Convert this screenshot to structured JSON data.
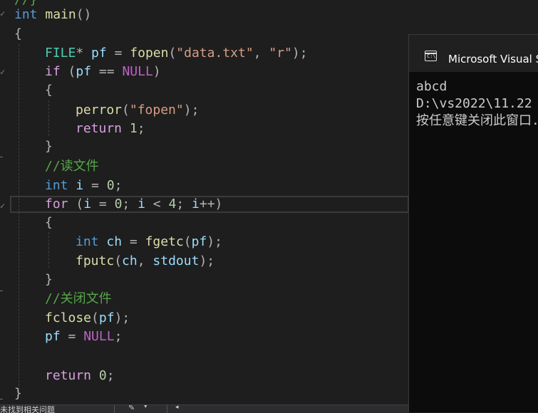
{
  "editor": {
    "lines": [
      {
        "t": "//}"
      },
      {
        "t": "int main()"
      },
      {
        "t": "{"
      },
      {
        "t": "FILE* pf = fopen(\"data.txt\", \"r\");"
      },
      {
        "t": "if (pf == NULL)"
      },
      {
        "t": "{"
      },
      {
        "t": "perror(\"fopen\");"
      },
      {
        "t": "return 1;"
      },
      {
        "t": "}"
      },
      {
        "t": "//读文件"
      },
      {
        "t": "int i = 0;"
      },
      {
        "t": "for (i = 0; i < 4; i++)"
      },
      {
        "t": "{"
      },
      {
        "t": "int ch = fgetc(pf);"
      },
      {
        "t": "fputc(ch, stdout);"
      },
      {
        "t": "}"
      },
      {
        "t": "//关闭文件"
      },
      {
        "t": "fclose(pf);"
      },
      {
        "t": "pf = NULL;"
      },
      {
        "t": ""
      },
      {
        "t": "return 0;"
      },
      {
        "t": "}"
      }
    ],
    "tokens": {
      "l1_int": "int",
      "l1_main": "main",
      "l1_paren": "()",
      "l3_file": "FILE",
      "l3_star": "*",
      "l3_pf": "pf",
      "l3_eq": "=",
      "l3_fopen": "fopen",
      "l3_po": "(",
      "l3_s1": "\"data.txt\"",
      "l3_comma": ",",
      "l3_s2": "\"r\"",
      "l3_pc": ");",
      "l4_if": "if",
      "l4_po": "(",
      "l4_pf": "pf",
      "l4_eq": "==",
      "l4_null": "NULL",
      "l4_pc": ")",
      "l6_perror": "perror",
      "l6_po": "(",
      "l6_s": "\"fopen\"",
      "l6_pc": ");",
      "l7_return": "return",
      "l7_num": "1",
      "l7_semi": ";",
      "l9_cmt": "//读文件",
      "l10_int": "int",
      "l10_i": "i",
      "l10_eq": "=",
      "l10_num": "0",
      "l10_semi": ";",
      "l11_for": "for",
      "l11_po": "(",
      "l11_i1": "i",
      "l11_eq": "=",
      "l11_n0": "0",
      "l11_s1": ";",
      "l11_i2": "i",
      "l11_lt": "<",
      "l11_n4": "4",
      "l11_s2": ";",
      "l11_i3": "i",
      "l11_pp": "++",
      "l11_pc": ")",
      "l13_int": "int",
      "l13_ch": "ch",
      "l13_eq": "=",
      "l13_fgetc": "fgetc",
      "l13_po": "(",
      "l13_pf": "pf",
      "l13_pc": ");",
      "l14_fputc": "fputc",
      "l14_po": "(",
      "l14_ch": "ch",
      "l14_comma": ",",
      "l14_stdout": "stdout",
      "l14_pc": ");",
      "l16_cmt": "//关闭文件",
      "l17_fclose": "fclose",
      "l17_po": "(",
      "l17_pf": "pf",
      "l17_pc": ");",
      "l18_pf": "pf",
      "l18_eq": "=",
      "l18_null": "NULL",
      "l18_semi": ";",
      "l20_return": "return",
      "l20_num": "0",
      "l20_semi": ";"
    }
  },
  "status_bar": {
    "issues_text": "未找到相关问题"
  },
  "console": {
    "title": "Microsoft Visual Studio 调试控制台",
    "icon": "console-app-icon",
    "output_lines": [
      "abcd",
      "D:\\vs2022\\11.22",
      "按任意键关闭此窗口. . ."
    ]
  },
  "colors": {
    "editor_bg": "#1e1e1e",
    "keyword": "#569cd6",
    "function": "#dcdcaa",
    "variable": "#9cdcfe",
    "string": "#d69d85",
    "comment": "#57a64a",
    "macro": "#bd63c5",
    "console_bg": "#0c0c0c"
  }
}
